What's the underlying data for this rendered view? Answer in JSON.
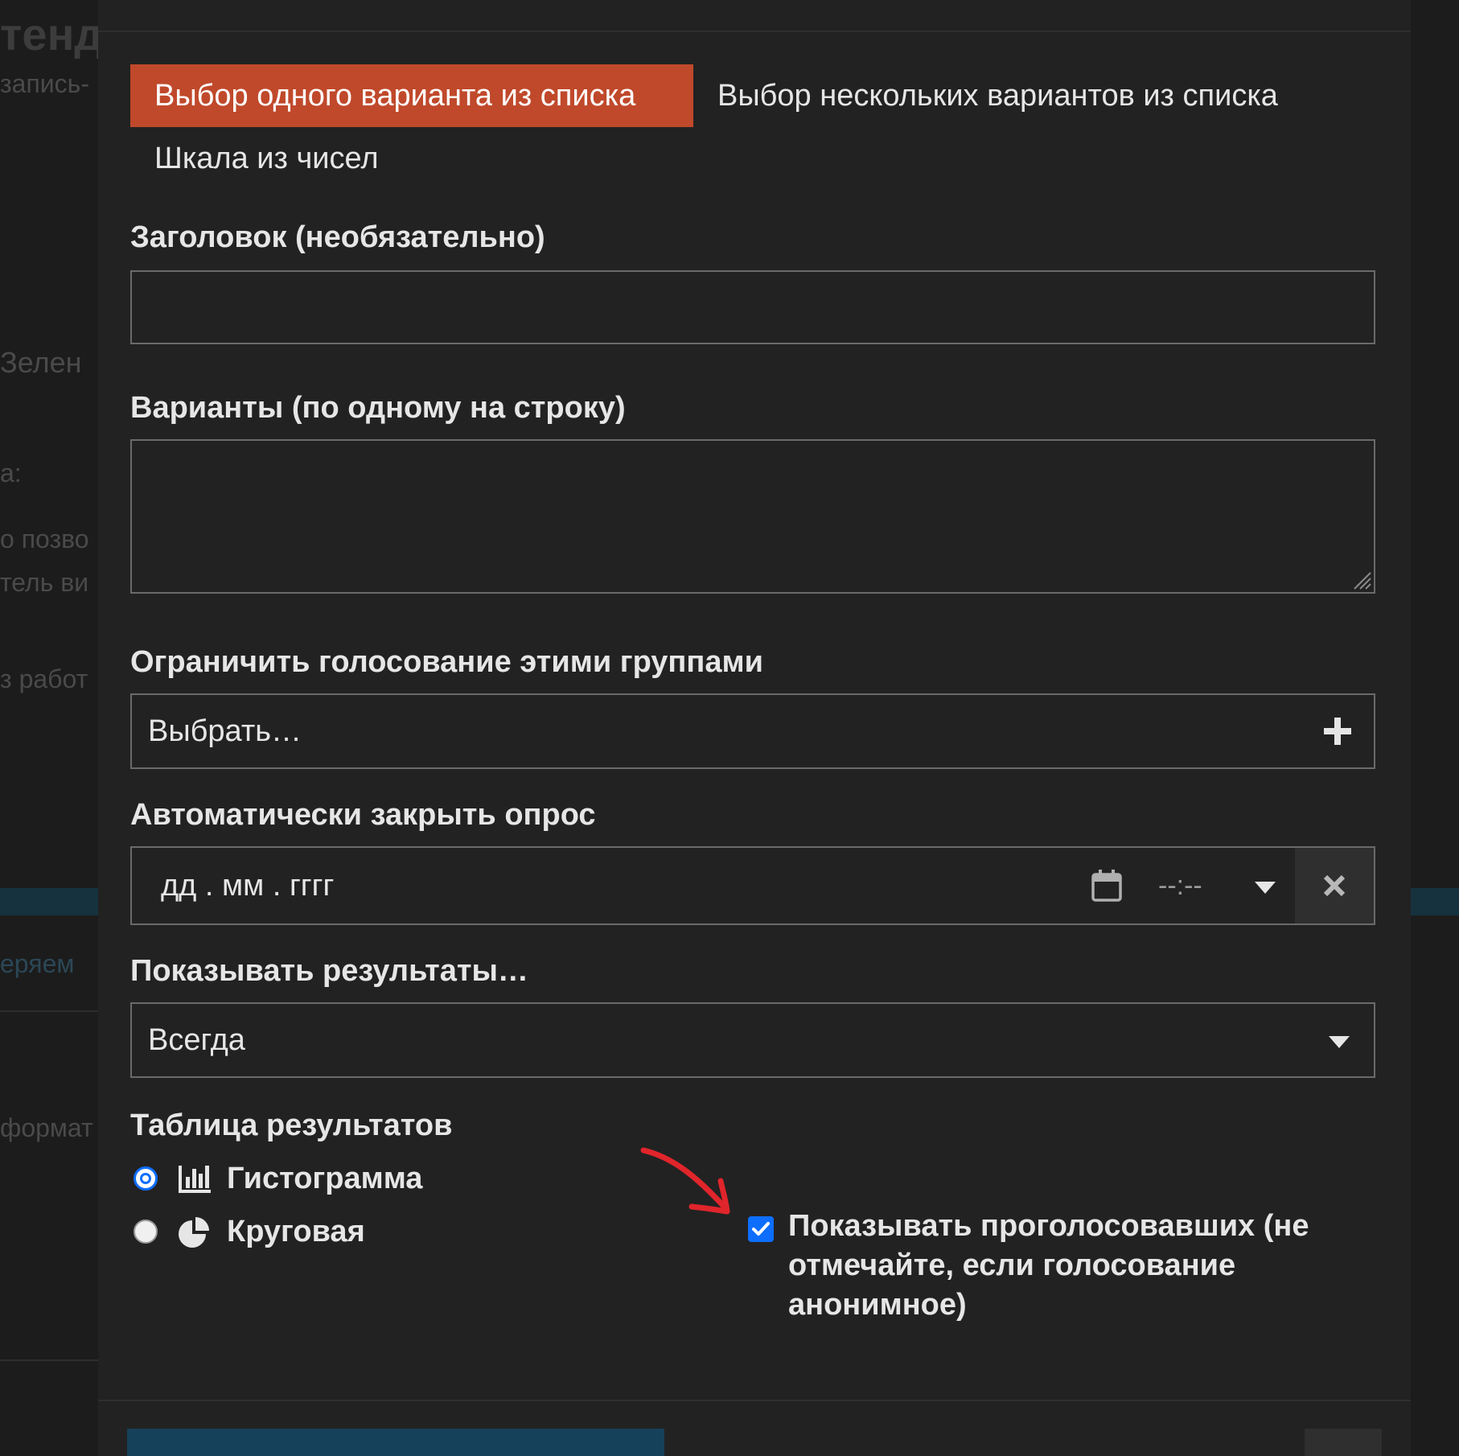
{
  "background": {
    "fragments": [
      "тенд",
      "запись-",
      "Зелен",
      "а:",
      "о позво",
      "тель ви",
      "з работ",
      "еряем",
      "формат"
    ]
  },
  "tabs": [
    {
      "label": "Выбор одного варианта из списка",
      "active": true
    },
    {
      "label": "Выбор нескольких вариантов из списка",
      "active": false
    },
    {
      "label": "Шкала из чисел",
      "active": false
    }
  ],
  "title_field": {
    "label": "Заголовок (необязательно)",
    "value": ""
  },
  "options_field": {
    "label": "Варианты (по одному на строку)",
    "value": ""
  },
  "groups_field": {
    "label": "Ограничить голосование этими группами",
    "placeholder": "Выбрать…"
  },
  "autoclose_field": {
    "label": "Автоматически закрыть опрос",
    "date_placeholder": "дд . мм . гггг",
    "time_placeholder": "--:--"
  },
  "results_field": {
    "label": "Показывать результаты…",
    "selected": "Всегда"
  },
  "chart_type": {
    "label": "Таблица результатов",
    "options": [
      {
        "label": "Гистограмма",
        "selected": true,
        "icon": "bar-chart-icon"
      },
      {
        "label": "Круговая",
        "selected": false,
        "icon": "pie-chart-icon"
      }
    ]
  },
  "show_voters": {
    "label": "Показывать проголосовавших (не отмечайте, если голосование анонимное)",
    "checked": true
  },
  "colors": {
    "accent": "#c0492b",
    "primary": "#0d6efd",
    "annotation": "#e0252b"
  }
}
